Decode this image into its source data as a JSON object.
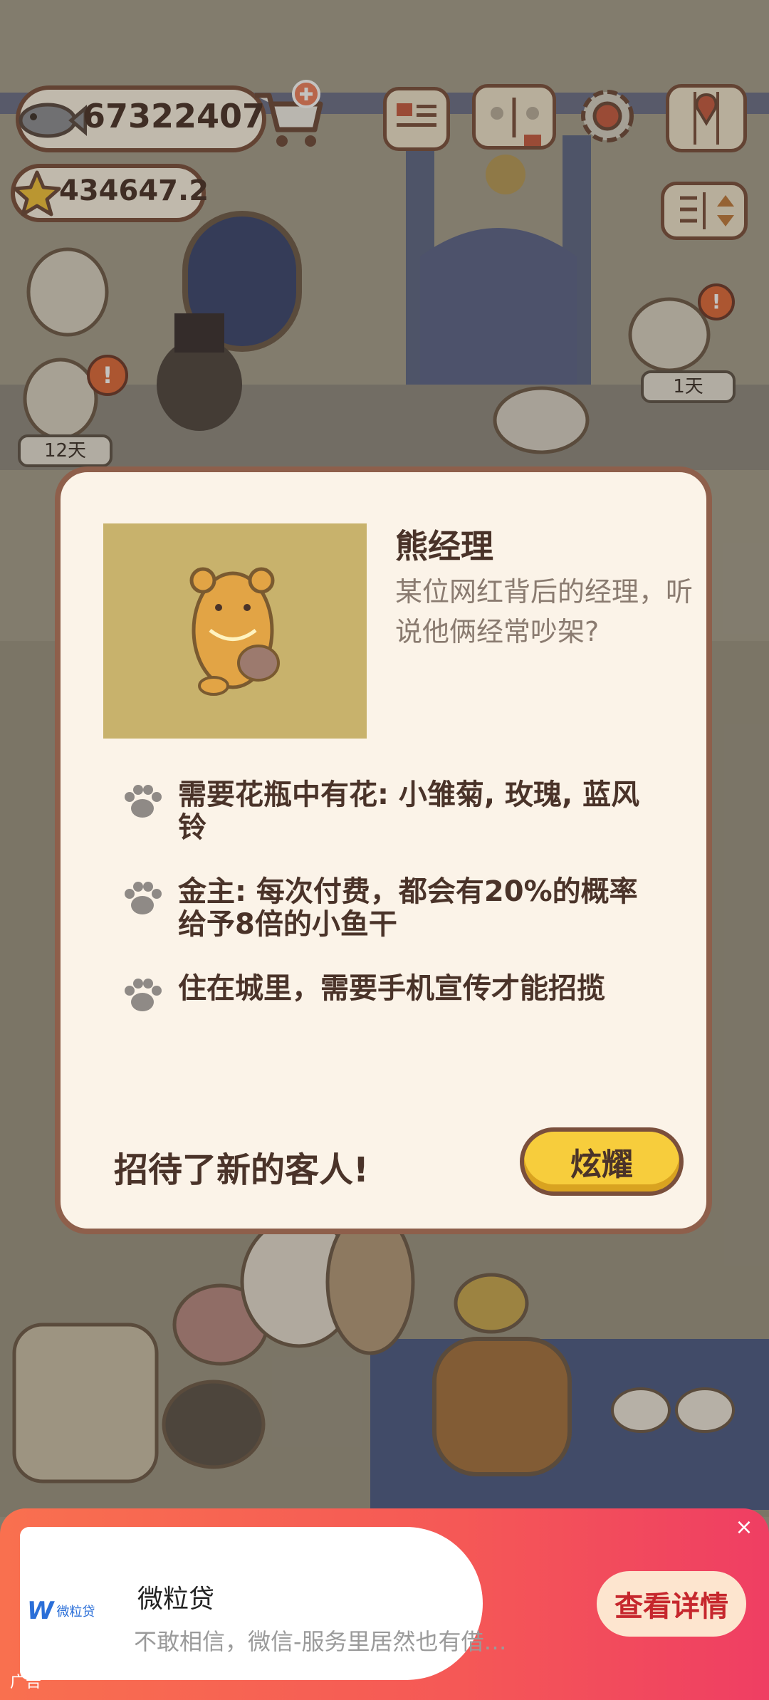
{
  "hud": {
    "fish_count": "67322407",
    "star_count": "434647.2",
    "icons": [
      "fish-icon",
      "cart-add-icon",
      "menu-card-icon",
      "paw-book-icon",
      "settings-gear-icon",
      "map-icon",
      "sort-toggle-icon",
      "star-icon"
    ]
  },
  "scene": {
    "timer_left": "12天",
    "timer_right": "1天"
  },
  "dialog": {
    "name": "熊经理",
    "description": "某位网红背后的经理，听说他俩经常吵架?",
    "traits": [
      "需要花瓶中有花: 小雏菊, 玫瑰, 蓝风铃",
      "金主: 每次付费，都会有20%的概率给予8倍的小鱼干",
      "住在城里，需要手机宣传才能招揽"
    ],
    "footer_text": "招待了新的客人!",
    "show_button": "炫耀"
  },
  "ad": {
    "brand_logo_text": "微粒贷",
    "title": "微粒贷",
    "subtitle": "不敢相信，微信-服务里居然也有借…",
    "cta": "查看详情",
    "close": "×",
    "label": "广告"
  },
  "colors": {
    "card_bg": "#fbf3e8",
    "card_border": "#8e5f4b",
    "button_yellow": "#f7cd3c",
    "text_dark": "#4a3329",
    "ad_gradient_start": "#f9704f",
    "ad_gradient_end": "#ef3e63"
  }
}
